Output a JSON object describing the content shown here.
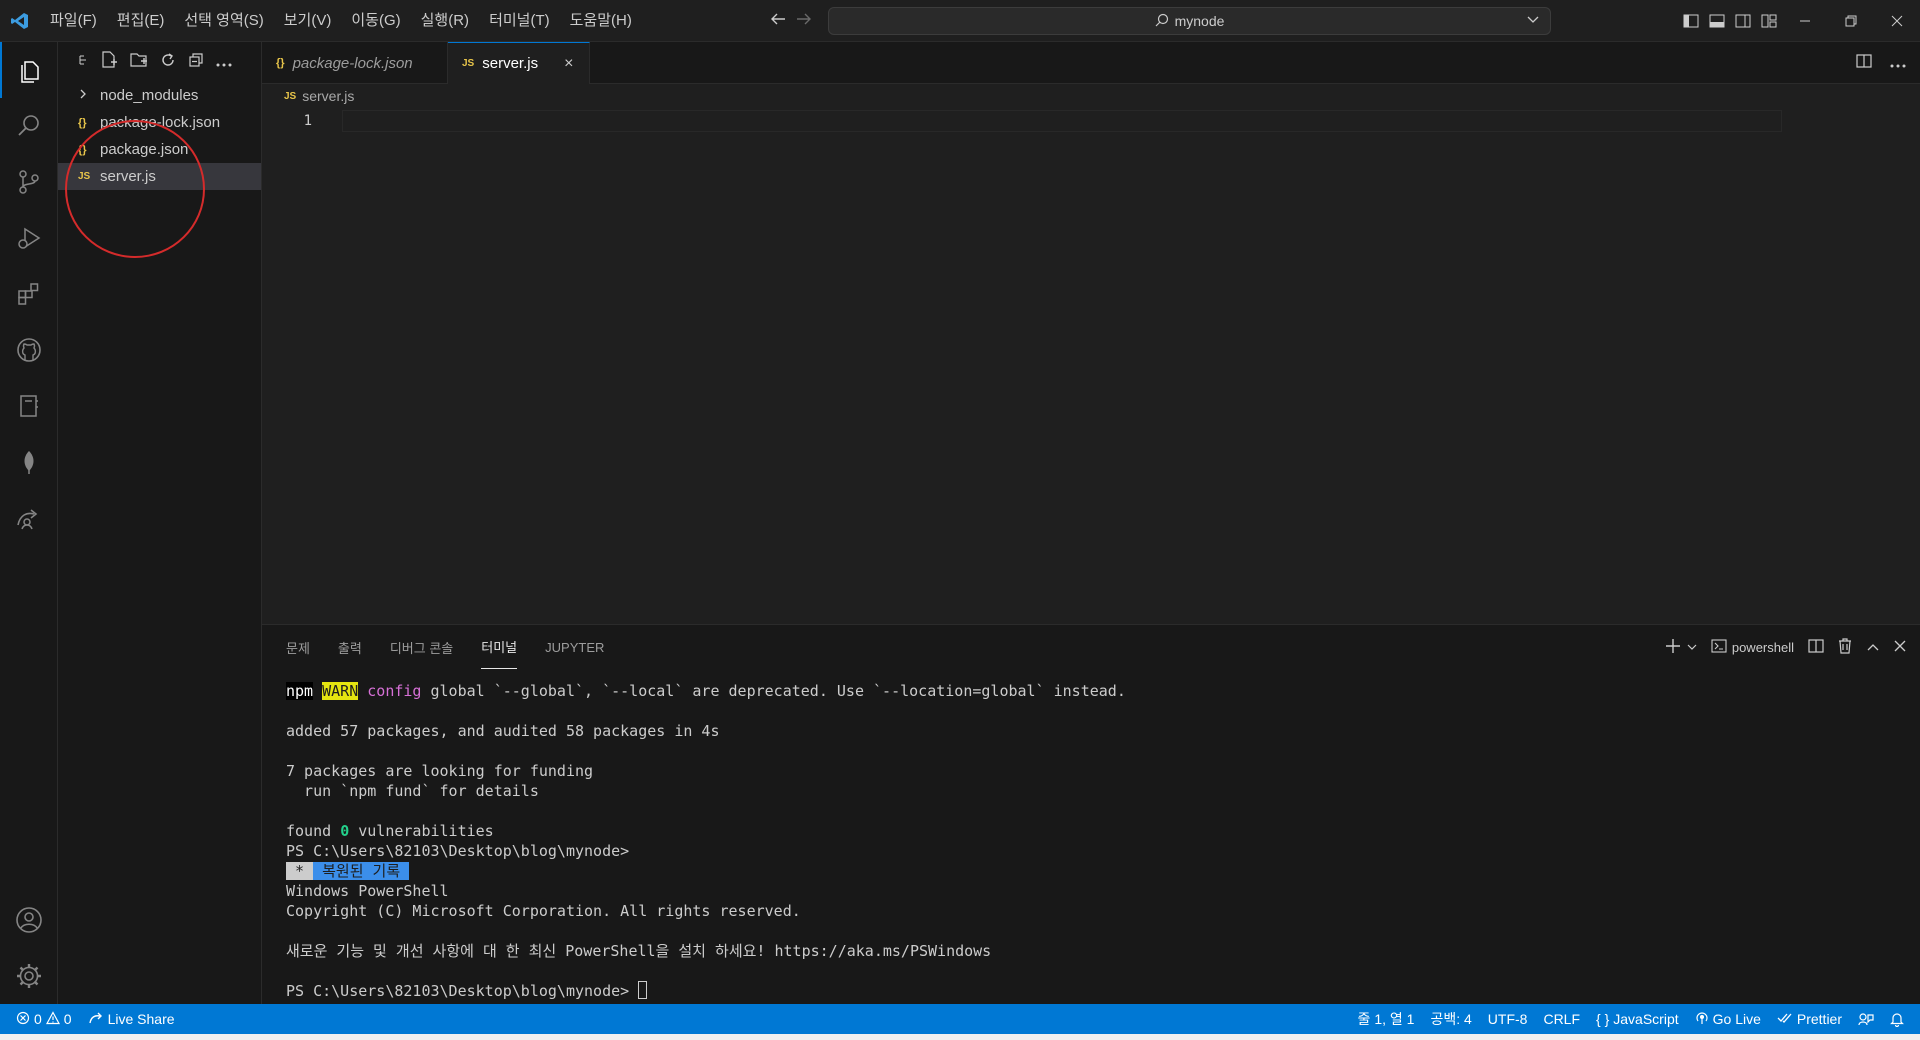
{
  "menu": [
    "파일(F)",
    "편집(E)",
    "선택 영역(S)",
    "보기(V)",
    "이동(G)",
    "실행(R)",
    "터미널(T)",
    "도움말(H)"
  ],
  "search": {
    "text": "mynode"
  },
  "sidebar": {
    "items": [
      {
        "label": "node_modules",
        "icon": "chevron-right-icon"
      },
      {
        "label": "package-lock.json",
        "icon": "json-icon",
        "glyph": "{}"
      },
      {
        "label": "package.json",
        "icon": "json-icon",
        "glyph": "{}"
      },
      {
        "label": "server.js",
        "icon": "js-icon",
        "glyph": "JS"
      }
    ]
  },
  "tabs": [
    {
      "label": "package-lock.json",
      "glyph": "{}"
    },
    {
      "label": "server.js",
      "glyph": "JS",
      "close": "×"
    }
  ],
  "editor": {
    "breadcrumb": "server.js",
    "breadcrumb_glyph": "JS",
    "line_number": "1"
  },
  "panel": {
    "tabs": [
      "문제",
      "출력",
      "디버그 콘솔",
      "터미널",
      "JUPYTER"
    ],
    "shell": "powershell"
  },
  "terminal": {
    "warn_npm": "npm",
    "warn_tag": "WARN",
    "warn_config": "config",
    "warn_rest": " global `--global`, `--local` are deprecated. Use `--location=global` instead.",
    "added": "added 57 packages, and audited 58 packages in 4s",
    "funding": "7 packages are looking for funding",
    "fund_hint": "  run `npm fund` for details",
    "found_a": "found ",
    "found_zero": "0",
    "found_b": " vulnerabilities",
    "prompt1": "PS C:\\Users\\82103\\Desktop\\blog\\mynode>",
    "restored_star": " * ",
    "restored_text": " 복원된 기록 ",
    "ps_title": "Windows PowerShell",
    "copyright": "Copyright (C) Microsoft Corporation. All rights reserved.",
    "new_ps": "새로운 기능 및 개선 사항에 대 한 최신 PowerShell을 설치 하세요! https://aka.ms/PSWindows",
    "prompt2": "PS C:\\Users\\82103\\Desktop\\blog\\mynode> "
  },
  "status": {
    "errors": "0",
    "warnings": "0",
    "live_share": "Live Share",
    "position": "줄 1, 열 1",
    "spaces": "공백: 4",
    "encoding": "UTF-8",
    "eol": "CRLF",
    "language": "JavaScript",
    "go_live": "Go Live",
    "prettier": "Prettier"
  },
  "colors": {
    "accent": "#0078d4",
    "annotation": "#d42b2b",
    "warn": "#e5e510"
  }
}
